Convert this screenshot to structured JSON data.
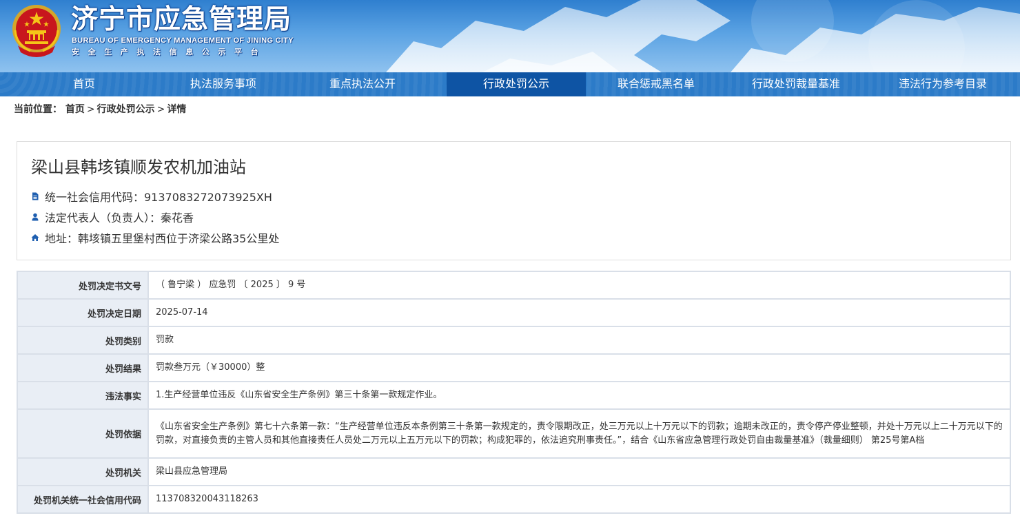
{
  "header": {
    "title": "济宁市应急管理局",
    "subtitle_en": "BUREAU OF EMERGENCY MANAGEMENT OF JINING CITY",
    "subtitle_cn": "安全生产执法信息公示平台",
    "colors": {
      "banner": "#2f7fcf",
      "nav": "#2c7bc8",
      "nav_active": "#0e54a4"
    }
  },
  "nav": {
    "items": [
      {
        "label": "首页"
      },
      {
        "label": "执法服务事项"
      },
      {
        "label": "重点执法公开"
      },
      {
        "label": "行政处罚公示",
        "active": true
      },
      {
        "label": "联合惩戒黑名单"
      },
      {
        "label": "行政处罚裁量基准"
      },
      {
        "label": "违法行为参考目录"
      }
    ]
  },
  "breadcrumb": {
    "prefix": "当前位置：",
    "items": [
      "首页",
      "行政处罚公示",
      "详情"
    ],
    "separator": ">"
  },
  "company": {
    "name": "梁山县韩垓镇顺发农机加油站",
    "credit_code_text": "统一社会信用代码：9137083272073925XH",
    "legal_rep_text": "法定代表人（负责人）：秦花香",
    "address_text": "地址：韩垓镇五里堡村西位于济梁公路35公里处",
    "icons": [
      "document-icon",
      "user-icon",
      "home-icon"
    ]
  },
  "details": {
    "rows": [
      {
        "label": "处罚决定书文号",
        "value": "（ 鲁宁梁 ） 应急罚 〔 2025 〕 9 号"
      },
      {
        "label": "处罚决定日期",
        "value": "2025-07-14"
      },
      {
        "label": "处罚类别",
        "value": "罚款"
      },
      {
        "label": "处罚结果",
        "value": "罚款叁万元（￥30000）整"
      },
      {
        "label": "违法事实",
        "value": "1.生产经营单位违反《山东省安全生产条例》第三十条第一款规定作业。"
      },
      {
        "label": "处罚依据",
        "value": "《山东省安全生产条例》第七十六条第一款：“生产经营单位违反本条例第三十条第一款规定的，责令限期改正，处三万元以上十万元以下的罚款；逾期未改正的，责令停产停业整顿，并处十万元以上二十万元以下的罚款，对直接负责的主管人员和其他直接责任人员处二万元以上五万元以下的罚款；构成犯罪的，依法追究刑事责任。”，结合《山东省应急管理行政处罚自由裁量基准》（裁量细则） 第25号第A档"
      },
      {
        "label": "处罚机关",
        "value": "梁山县应急管理局"
      },
      {
        "label": "处罚机关统一社会信用代码",
        "value": "113708320043118263"
      }
    ]
  }
}
